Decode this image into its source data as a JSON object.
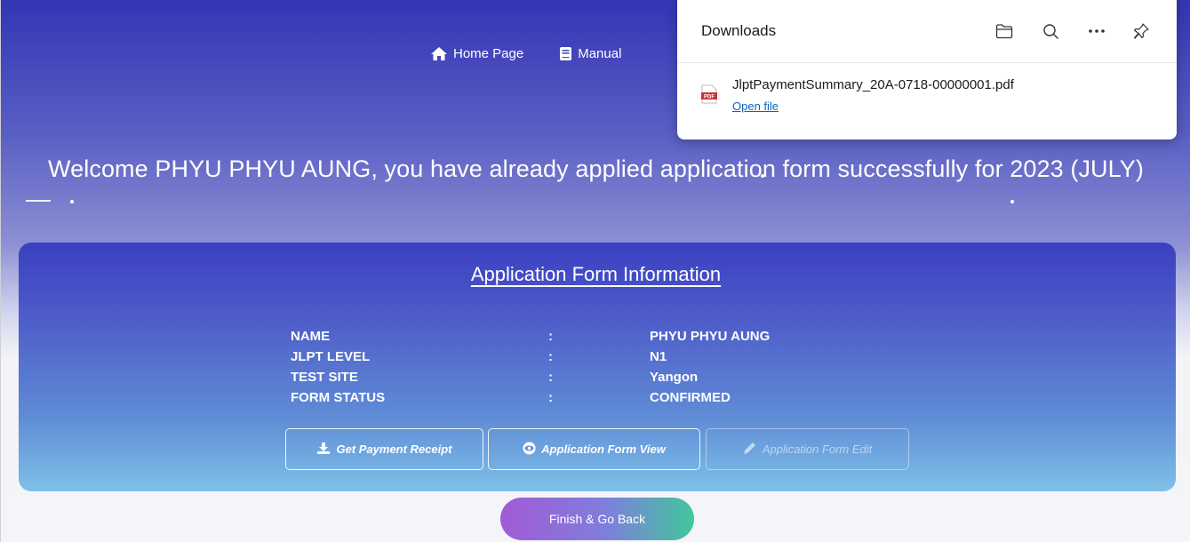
{
  "nav": {
    "home_label": "Home Page",
    "manual_label": "Manual"
  },
  "welcome": {
    "message": "Welcome PHYU PHYU AUNG, you have already applied application form successfully for 2023 (JULY)"
  },
  "card": {
    "title": "Application Form Information",
    "rows": [
      {
        "label": "NAME",
        "colon": ":",
        "value": "PHYU PHYU AUNG"
      },
      {
        "label": "JLPT LEVEL",
        "colon": ":",
        "value": "N1"
      },
      {
        "label": "TEST SITE",
        "colon": ":",
        "value": "Yangon"
      },
      {
        "label": "FORM STATUS",
        "colon": ":",
        "value": "CONFIRMED"
      }
    ],
    "buttons": {
      "receipt_label": "Get Payment Receipt",
      "view_label": "Application Form View",
      "edit_label": "Application Form Edit"
    }
  },
  "finish": {
    "label": "Finish & Go Back"
  },
  "downloads": {
    "title": "Downloads",
    "file_name": "JlptPaymentSummary_20A-0718-00000001.pdf",
    "open_label": "Open file",
    "file_badge": "PDF"
  },
  "colors": {
    "hero_top": "#3435b5",
    "card_top": "#3b3fc1",
    "card_bottom": "#7fc0e8",
    "finish_start": "#a25ad6",
    "finish_end": "#41c79c",
    "link": "#0c64c0"
  },
  "icons": [
    "home-icon",
    "manual-icon",
    "download-icon",
    "eye-icon",
    "pencil-icon",
    "folder-icon",
    "search-icon",
    "more-icon",
    "pin-icon",
    "pdf-file-icon"
  ]
}
